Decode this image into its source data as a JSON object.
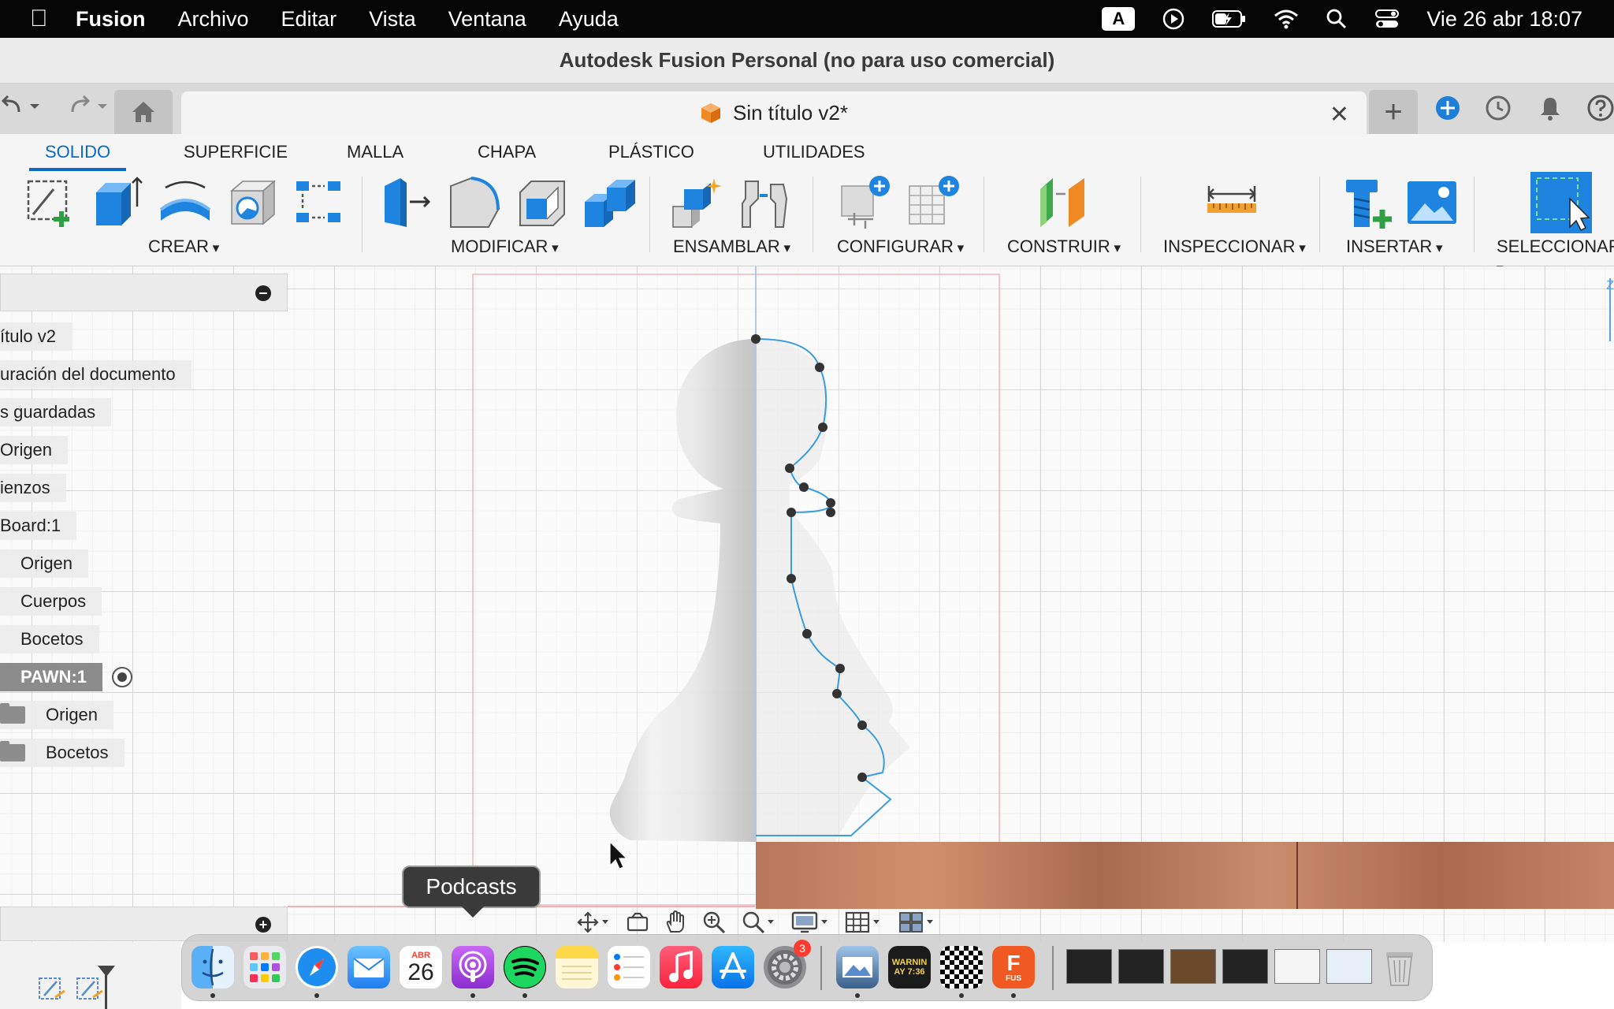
{
  "menubar": {
    "apple_icon": "apple-icon",
    "app_name": "Fusion",
    "items": [
      "Archivo",
      "Editar",
      "Vista",
      "Ventana",
      "Ayuda"
    ],
    "keyboard_badge": "A",
    "datetime": "Vie 26 abr 18:07"
  },
  "window": {
    "title": "Autodesk Fusion Personal (no para uso comercial)"
  },
  "tabs": {
    "document_title": "Sin título v2*",
    "close_glyph": "✕",
    "plus_glyph": "+"
  },
  "toolbar": {
    "tabs": [
      "SOLIDO",
      "SUPERFICIE",
      "MALLA",
      "CHAPA",
      "PLÁSTICO",
      "UTILIDADES"
    ],
    "active_tab": "SOLIDO",
    "accent_color": "#0b69c9",
    "groups": [
      "CREAR",
      "MODIFICAR",
      "ENSAMBLAR",
      "CONFIGURAR",
      "CONSTRUIR",
      "INSPECCIONAR",
      "INSERTAR",
      "SELECCIONAR"
    ]
  },
  "browser": {
    "items": [
      {
        "label": "ítulo v2"
      },
      {
        "label": "uración del documento"
      },
      {
        "label": "s guardadas"
      },
      {
        "label": "Origen"
      },
      {
        "label": "ienzos"
      },
      {
        "label": "Board:1"
      },
      {
        "label": "Origen"
      },
      {
        "label": "Cuerpos"
      },
      {
        "label": "Bocetos"
      },
      {
        "label": "PAWN:1"
      },
      {
        "label": "Origen"
      },
      {
        "label": "Bocetos"
      }
    ]
  },
  "canvas": {
    "viewcube_label": "Z"
  },
  "dock": {
    "tooltip": "Podcasts",
    "calendar_month": "ABR",
    "calendar_day": "26",
    "settings_badge": "3",
    "console_text": "WARNIN\nAY 7:36",
    "fusion_label": "FUS",
    "apps": [
      "Finder",
      "Launchpad",
      "Safari",
      "Mail",
      "Calendario",
      "Podcasts",
      "Spotify",
      "Notas",
      "Recordatorios",
      "Música",
      "App Store",
      "Ajustes del Sistema",
      "Vista Previa",
      "Consola",
      "Ajedrez",
      "Fusion",
      "Papelera"
    ]
  }
}
